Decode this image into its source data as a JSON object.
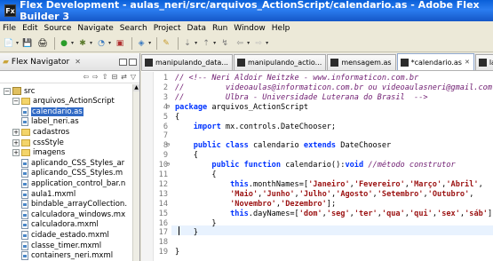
{
  "window": {
    "title": "Flex Development - aulas_neri/src/arquivos_ActionScript/calendario.as - Adobe Flex Builder 3",
    "icon_label": "Fx"
  },
  "menu": [
    "File",
    "Edit",
    "Source",
    "Navigate",
    "Search",
    "Project",
    "Data",
    "Run",
    "Window",
    "Help"
  ],
  "toolbar": {
    "icons": [
      "new-icon",
      "save-icon",
      "print-icon",
      "run-icon",
      "debug-icon",
      "profile-icon",
      "external-tool-icon",
      "open-type-icon",
      "search-icon",
      "annotation-icon",
      "next-annotation-icon",
      "previous-annotation-icon",
      "back-icon",
      "forward-icon"
    ]
  },
  "navigator": {
    "title": "Flex Navigator",
    "close_glyph": "✕",
    "tree": [
      {
        "label": "src",
        "depth": 0,
        "type": "src",
        "expanded": true
      },
      {
        "label": "arquivos_ActionScript",
        "depth": 1,
        "type": "folder",
        "expanded": true
      },
      {
        "label": "calendario.as",
        "depth": 2,
        "type": "file",
        "selected": true
      },
      {
        "label": "label_neri.as",
        "depth": 2,
        "type": "file"
      },
      {
        "label": "cadastros",
        "depth": 1,
        "type": "folder",
        "expanded": false
      },
      {
        "label": "cssStyle",
        "depth": 1,
        "type": "folder",
        "expanded": false
      },
      {
        "label": "imagens",
        "depth": 1,
        "type": "folder",
        "expanded": false
      },
      {
        "label": "aplicando_CSS_Styles_ar",
        "depth": 1,
        "type": "file"
      },
      {
        "label": "aplicando_CSS_Styles.m",
        "depth": 1,
        "type": "file"
      },
      {
        "label": "application_control_bar.n",
        "depth": 1,
        "type": "file"
      },
      {
        "label": "aula1.mxml",
        "depth": 1,
        "type": "file"
      },
      {
        "label": "bindable_arrayCollection.",
        "depth": 1,
        "type": "file"
      },
      {
        "label": "calculadora_windows.mx",
        "depth": 1,
        "type": "file"
      },
      {
        "label": "calculadora.mxml",
        "depth": 1,
        "type": "file"
      },
      {
        "label": "cidade_estado.mxml",
        "depth": 1,
        "type": "file"
      },
      {
        "label": "classe_timer.mxml",
        "depth": 1,
        "type": "file"
      },
      {
        "label": "containers_neri.mxml",
        "depth": 1,
        "type": "file"
      }
    ]
  },
  "editor": {
    "tabs": [
      {
        "label": "manipulando_data...",
        "active": false
      },
      {
        "label": "manipulando_actio...",
        "active": false
      },
      {
        "label": "mensagem.as",
        "active": false
      },
      {
        "label": "*calendario.as",
        "active": true
      },
      {
        "label": "label_n",
        "active": false
      }
    ],
    "tab_close_glyph": "✕",
    "lines": [
      {
        "n": "1",
        "segs": [
          {
            "t": "// <!-- Neri Aldoir Neitzke - www.informaticon.com.br",
            "k": "c"
          }
        ]
      },
      {
        "n": "2",
        "segs": [
          {
            "t": "//         videoaulas@informaticon.com.br ou videoaulasneri@gmail.com",
            "k": "c"
          }
        ]
      },
      {
        "n": "3",
        "segs": [
          {
            "t": "//         Ulbra - Universidade Luterana do Brasil  -->",
            "k": "c"
          }
        ]
      },
      {
        "n": "4",
        "fold": "⊖",
        "segs": [
          {
            "t": "package",
            "k": "kw"
          },
          {
            "t": " arquivos_ActionScript",
            "k": ""
          }
        ]
      },
      {
        "n": "5",
        "segs": [
          {
            "t": "{",
            "k": ""
          }
        ]
      },
      {
        "n": "6",
        "segs": [
          {
            "t": "    ",
            "k": ""
          },
          {
            "t": "import",
            "k": "kw"
          },
          {
            "t": " mx.controls.DateChooser;",
            "k": ""
          }
        ]
      },
      {
        "n": "7",
        "segs": [
          {
            "t": "",
            "k": ""
          }
        ]
      },
      {
        "n": "8",
        "fold": "⊖",
        "segs": [
          {
            "t": "    ",
            "k": ""
          },
          {
            "t": "public class",
            "k": "kw"
          },
          {
            "t": " calendario ",
            "k": ""
          },
          {
            "t": "extends",
            "k": "kw"
          },
          {
            "t": " DateChooser",
            "k": ""
          }
        ]
      },
      {
        "n": "9",
        "segs": [
          {
            "t": "    {",
            "k": ""
          }
        ]
      },
      {
        "n": "10",
        "fold": "⊖",
        "segs": [
          {
            "t": "        ",
            "k": ""
          },
          {
            "t": "public function",
            "k": "kw"
          },
          {
            "t": " calendario():",
            "k": ""
          },
          {
            "t": "void",
            "k": "kw"
          },
          {
            "t": " ",
            "k": ""
          },
          {
            "t": "//método construtor",
            "k": "c"
          }
        ]
      },
      {
        "n": "11",
        "segs": [
          {
            "t": "        {",
            "k": ""
          }
        ]
      },
      {
        "n": "12",
        "segs": [
          {
            "t": "            ",
            "k": ""
          },
          {
            "t": "this",
            "k": "kw"
          },
          {
            "t": ".monthNames=[",
            "k": ""
          },
          {
            "t": "'Janeiro'",
            "k": "str"
          },
          {
            "t": ",",
            "k": ""
          },
          {
            "t": "'Fevereiro'",
            "k": "str"
          },
          {
            "t": ",",
            "k": ""
          },
          {
            "t": "'Março'",
            "k": "str"
          },
          {
            "t": ",",
            "k": ""
          },
          {
            "t": "'Abril'",
            "k": "str"
          },
          {
            "t": ",",
            "k": ""
          }
        ]
      },
      {
        "n": "13",
        "segs": [
          {
            "t": "            ",
            "k": ""
          },
          {
            "t": "'Maio'",
            "k": "str"
          },
          {
            "t": ",",
            "k": ""
          },
          {
            "t": "'Junho'",
            "k": "str"
          },
          {
            "t": ",",
            "k": ""
          },
          {
            "t": "'Julho'",
            "k": "str"
          },
          {
            "t": ",",
            "k": ""
          },
          {
            "t": "'Agosto'",
            "k": "str"
          },
          {
            "t": ",",
            "k": ""
          },
          {
            "t": "'Setembro'",
            "k": "str"
          },
          {
            "t": ",",
            "k": ""
          },
          {
            "t": "'Outubro'",
            "k": "str"
          },
          {
            "t": ",",
            "k": ""
          }
        ]
      },
      {
        "n": "14",
        "segs": [
          {
            "t": "            ",
            "k": ""
          },
          {
            "t": "'Novembro'",
            "k": "str"
          },
          {
            "t": ",",
            "k": ""
          },
          {
            "t": "'Dezembro'",
            "k": "str"
          },
          {
            "t": "];",
            "k": ""
          }
        ]
      },
      {
        "n": "15",
        "segs": [
          {
            "t": "            ",
            "k": ""
          },
          {
            "t": "this",
            "k": "kw"
          },
          {
            "t": ".dayNames=[",
            "k": ""
          },
          {
            "t": "'dom'",
            "k": "str"
          },
          {
            "t": ",",
            "k": ""
          },
          {
            "t": "'seg'",
            "k": "str"
          },
          {
            "t": ",",
            "k": ""
          },
          {
            "t": "'ter'",
            "k": "str"
          },
          {
            "t": ",",
            "k": ""
          },
          {
            "t": "'qua'",
            "k": "str"
          },
          {
            "t": ",",
            "k": ""
          },
          {
            "t": "'qui'",
            "k": "str"
          },
          {
            "t": ",",
            "k": ""
          },
          {
            "t": "'sex'",
            "k": "str"
          },
          {
            "t": ",",
            "k": ""
          },
          {
            "t": "'sáb'",
            "k": "str"
          },
          {
            "t": "];",
            "k": ""
          }
        ]
      },
      {
        "n": "16",
        "segs": [
          {
            "t": "        }",
            "k": ""
          }
        ]
      },
      {
        "n": "17",
        "segs": [
          {
            "t": "    }",
            "k": ""
          }
        ]
      },
      {
        "n": "18",
        "segs": [
          {
            "t": "",
            "k": ""
          }
        ]
      },
      {
        "n": "19",
        "segs": [
          {
            "t": "}",
            "k": ""
          }
        ]
      }
    ]
  }
}
